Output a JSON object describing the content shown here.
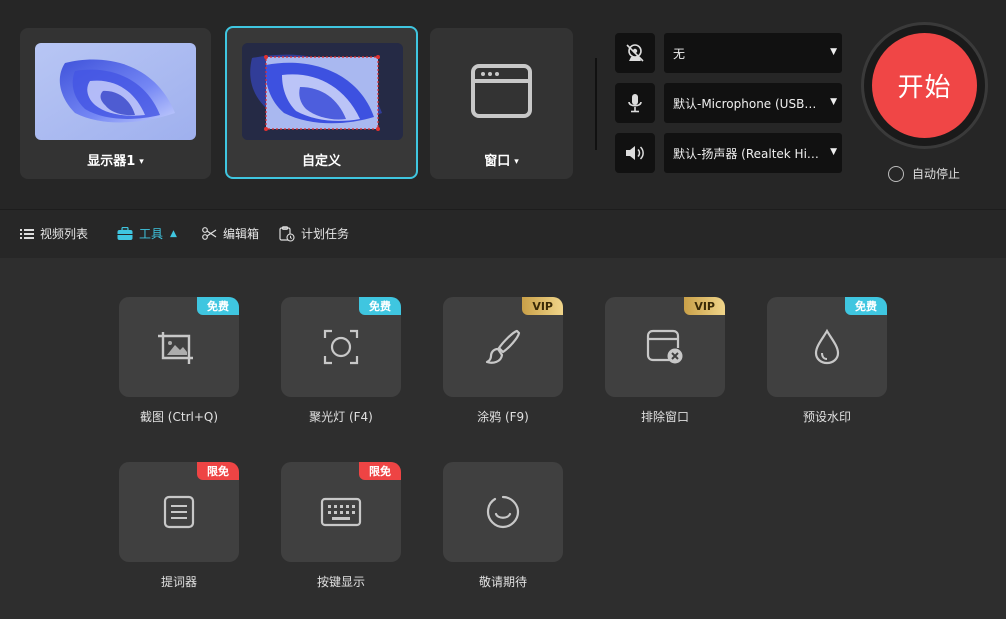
{
  "modes": [
    {
      "label": "显示器1",
      "caret": "▾"
    },
    {
      "label": "自定义",
      "caret": ""
    },
    {
      "label": "窗口",
      "caret": "▾"
    }
  ],
  "sources": {
    "camera": {
      "value": "无",
      "icon": "camera-off-icon"
    },
    "microphone": {
      "value": "默认-Microphone (USB Audio Device)",
      "icon": "microphone-icon"
    },
    "speaker": {
      "value": "默认-扬声器 (Realtek High Definition Audio)",
      "icon": "speaker-icon"
    }
  },
  "start": {
    "label": "开始",
    "color": "#f04646"
  },
  "auto_stop": {
    "label": "自动停止"
  },
  "nav": [
    {
      "label": "视频列表"
    },
    {
      "label": "工具",
      "active": true
    },
    {
      "label": "编辑箱"
    },
    {
      "label": "计划任务"
    }
  ],
  "tools": [
    {
      "label": "截图 (Ctrl+Q)",
      "badge": "免费",
      "badge_type": "free",
      "icon": "screenshot-crop-icon"
    },
    {
      "label": "聚光灯 (F4)",
      "badge": "免费",
      "badge_type": "free",
      "icon": "spotlight-icon"
    },
    {
      "label": "涂鸦 (F9)",
      "badge": "VIP",
      "badge_type": "vip",
      "icon": "brush-icon"
    },
    {
      "label": "排除窗口",
      "badge": "VIP",
      "badge_type": "vip",
      "icon": "exclude-window-icon"
    },
    {
      "label": "预设水印",
      "badge": "免费",
      "badge_type": "free",
      "icon": "watermark-drop-icon"
    },
    {
      "label": "提词器",
      "badge": "限免",
      "badge_type": "limit",
      "icon": "teleprompter-icon"
    },
    {
      "label": "按键显示",
      "badge": "限免",
      "badge_type": "limit",
      "icon": "keyboard-icon"
    },
    {
      "label": "敬请期待",
      "badge": "",
      "badge_type": "",
      "icon": "coming-soon-icon"
    }
  ],
  "colors": {
    "accent": "#3fc6e0",
    "start": "#f04646",
    "vip": "#e0c06a",
    "limit": "#ee4444"
  }
}
